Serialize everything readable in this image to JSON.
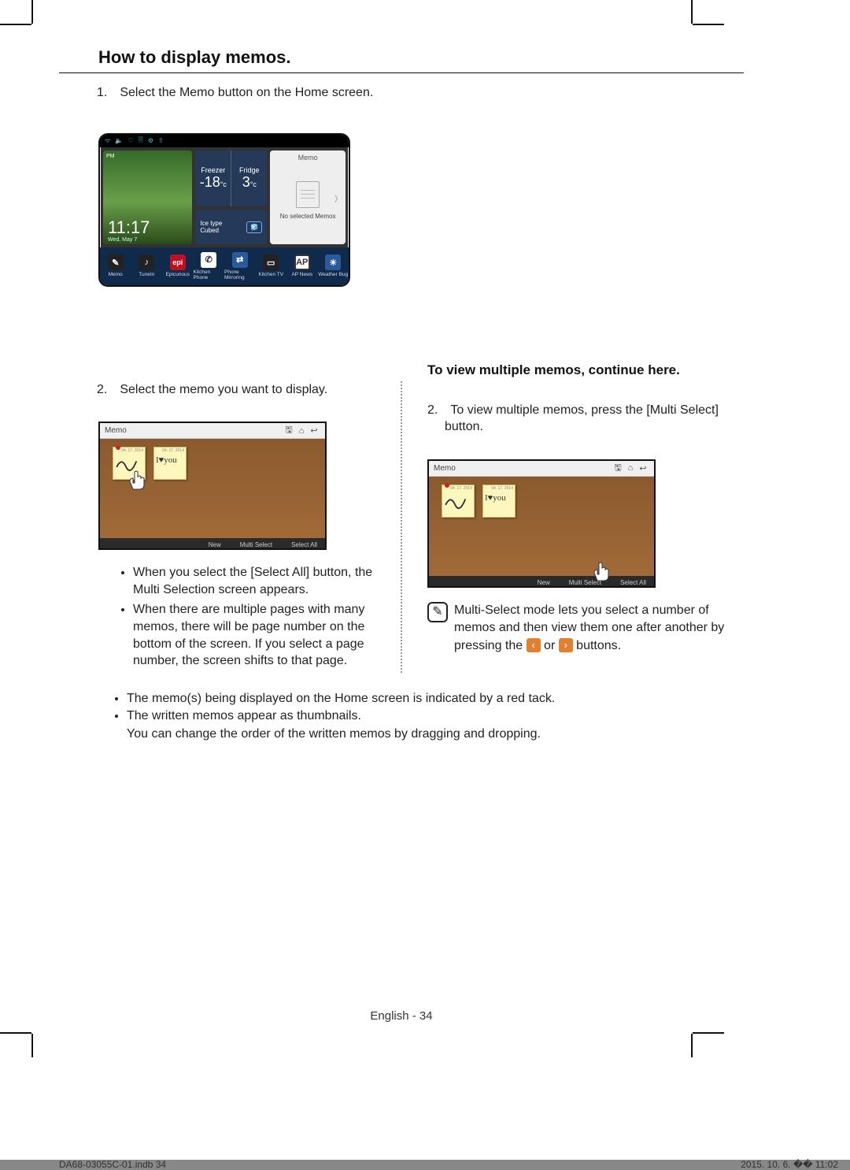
{
  "heading": "How to display memos.",
  "step1": "1. Select the Memo button on the Home screen.",
  "home": {
    "status_icons": [
      "📶",
      "🔈",
      "♡",
      "🗂",
      "⚙",
      "⇪"
    ],
    "freezer_label": "Freezer",
    "fridge_label": "Fridge",
    "freezer_temp": "-18",
    "fridge_temp": "3",
    "temp_unit": "°c",
    "ice_label": "Ice type",
    "ice_value": "Cubed",
    "time_ampm": "PM",
    "time": "11:17",
    "date": "Wed, May 7",
    "memo_label": "Memo",
    "memo_empty": "No selected Memos",
    "dock": [
      {
        "label": "Memo"
      },
      {
        "label": "TuneIn"
      },
      {
        "label": "Epicurious",
        "chip": "epi"
      },
      {
        "label": "Kitchen Phone"
      },
      {
        "label": "Phone Mirroring"
      },
      {
        "label": "Kitchen TV"
      },
      {
        "label": "AP News",
        "chip": "AP"
      },
      {
        "label": "Weather Bug"
      }
    ]
  },
  "left": {
    "step2": "2. Select the memo you want to display.",
    "bullets": [
      "When you select the [Select All] button, the Multi Selection screen appears.",
      "When there are multiple pages with many memos, there will be page number on the bottom of the screen. If you select a page number, the screen shifts to that page."
    ]
  },
  "right": {
    "subhead": "To view multiple memos, continue here.",
    "step2": "2. To view multiple memos, press the [Multi Select] button.",
    "note_pre": "Multi-Select mode lets you select a number of memos and then view them one after another by pressing the ",
    "note_mid": " or ",
    "note_post": " buttons."
  },
  "memoshot": {
    "title": "Memo",
    "note1_date": "04. 17. 2014",
    "note2_date": "04. 17. 2014",
    "note2_text": "I♥you",
    "btn_new": "New",
    "btn_multi": "Multi Select",
    "btn_all": "Select All"
  },
  "common_bullets": [
    "The memo(s) being displayed on the Home screen is indicated by a red tack.",
    "The written memos appear as thumbnails.\nYou can change the order of the written memos by dragging and dropping."
  ],
  "footer": {
    "center": "English - 34",
    "left": "DA68-03055C-01.indb   34",
    "right": "2015. 10. 6.   �� 11:02"
  }
}
